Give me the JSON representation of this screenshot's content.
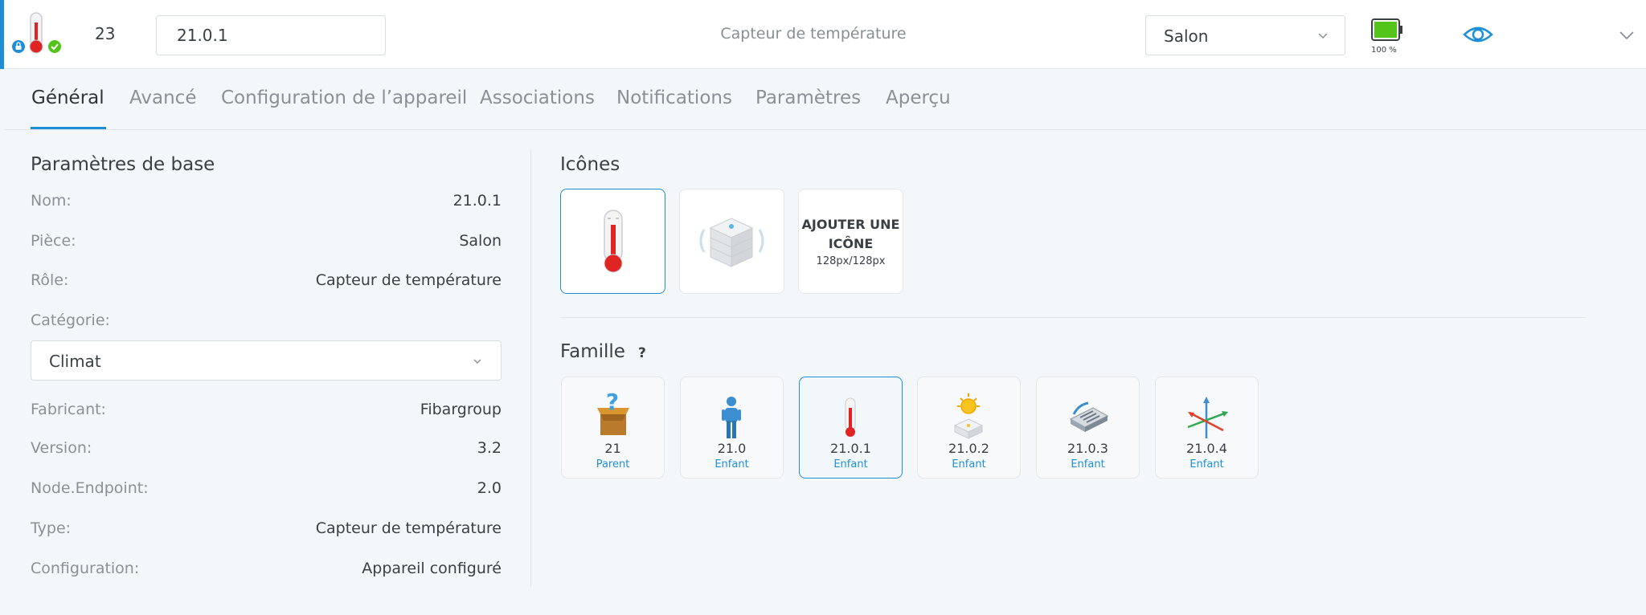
{
  "header": {
    "device_id": "23",
    "device_name": "21.0.1",
    "device_role": "Capteur de température",
    "room_select": "Salon",
    "battery_percent": 100,
    "battery_label": "100 %",
    "icons": [
      "thermometer-icon",
      "lock-badge-icon",
      "check-badge-icon",
      "eye-icon",
      "chevron-down-icon"
    ]
  },
  "tabs": [
    {
      "label": "Général",
      "active": true
    },
    {
      "label": "Avancé"
    },
    {
      "label": "Configuration de l’appareil"
    },
    {
      "label": "Associations"
    },
    {
      "label": "Notifications"
    },
    {
      "label": "Paramètres"
    },
    {
      "label": "Aperçu"
    }
  ],
  "basic": {
    "title": "Paramètres de base",
    "rows": [
      {
        "label": "Nom:",
        "value": "21.0.1"
      },
      {
        "label": "Pièce:",
        "value": "Salon"
      },
      {
        "label": "Rôle:",
        "value": "Capteur de température"
      }
    ],
    "category_label": "Catégorie:",
    "category_value": "Climat",
    "rows2": [
      {
        "label": "Fabricant:",
        "value": "Fibargroup"
      },
      {
        "label": "Version:",
        "value": "3.2"
      },
      {
        "label": "Node.Endpoint:",
        "value": "2.0"
      },
      {
        "label": "Type:",
        "value": "Capteur de température"
      },
      {
        "label": "Configuration:",
        "value": "Appareil configuré"
      }
    ]
  },
  "icons_section": {
    "title": "Icônes",
    "add_label": "AJOUTER UNE ICÔNE",
    "add_size": "128px/128px",
    "items": [
      "thermometer-icon",
      "device-box-icon"
    ]
  },
  "family": {
    "title": "Famille",
    "help": "?",
    "items": [
      {
        "id": "21",
        "role": "Parent",
        "icon": "parent-box-icon"
      },
      {
        "id": "21.0",
        "role": "Enfant",
        "icon": "person-icon"
      },
      {
        "id": "21.0.1",
        "role": "Enfant",
        "icon": "thermometer-icon",
        "selected": true
      },
      {
        "id": "21.0.2",
        "role": "Enfant",
        "icon": "light-sensor-icon"
      },
      {
        "id": "21.0.3",
        "role": "Enfant",
        "icon": "device-icon"
      },
      {
        "id": "21.0.4",
        "role": "Enfant",
        "icon": "axes-sensor-icon"
      }
    ]
  },
  "colors": {
    "accent": "#1e8fd6",
    "battery_green": "#52c41a",
    "thermo_red": "#e02424"
  }
}
